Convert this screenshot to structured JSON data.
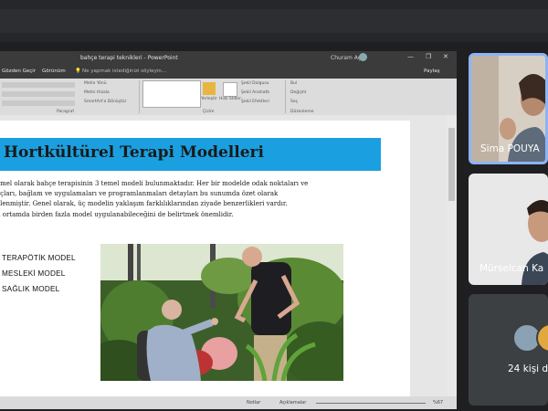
{
  "powerpoint": {
    "window_title": "bahçe terapi teknikleri  -  PowerPoint",
    "user_name": "Churam Aç",
    "window_controls": [
      "—",
      "❐",
      "✕"
    ],
    "menu": {
      "tab1": "Gözden Geçir",
      "tab2": "Görünüm",
      "tell_me": "Ne yapmak istediğinizi söyleyin...",
      "share": "Paylaş"
    },
    "ribbon": {
      "items": [
        "Metin Yönü",
        "Metni Hizala",
        "SmartArt'a Dönüştür",
        "Yerleştir",
        "Hızlı Stiller",
        "Şekil Dolgusu",
        "Şekil Anahattı",
        "Şekil Efektleri",
        "Bul",
        "Değiştir",
        "Seç"
      ],
      "groups": [
        "Paragraf",
        "Çizim",
        "Düzenleme"
      ]
    },
    "status": {
      "notes": "Notlar",
      "comments": "Açıklamalar",
      "zoom": "%67"
    }
  },
  "slide": {
    "title": "Hortkültürel Terapi Modelleri",
    "paragraph_lines": [
      "emel olarak bahçe terapisinin 3 temel modeli bulunmaktadır. Her bir modelde odak noktaları ve",
      "açları, bağlam ve uygulamaları ve programlanmaları detayları bu sunumda özet olarak",
      "elenmiştir. Genel olarak, üç modelin yaklaşım farklılıklarından ziyade benzerlikleri vardır.",
      "n ortamda birden fazla model uygulanabileceğini de belirtmek önemlidir."
    ],
    "models": [
      "TERAPÖTİK MODEL",
      "MESLEKİ MODEL",
      "SAĞLIK MODEL"
    ]
  },
  "participants": {
    "tiles": [
      {
        "name": "Sima POUYA"
      },
      {
        "name": "Mürselcan Ka"
      }
    ],
    "others_label": "24 kişi d"
  },
  "colors": {
    "title_bar": "#1aa0e0",
    "active_speaker_border": "#8ab4f8",
    "meet_background": "#1f1f22"
  }
}
